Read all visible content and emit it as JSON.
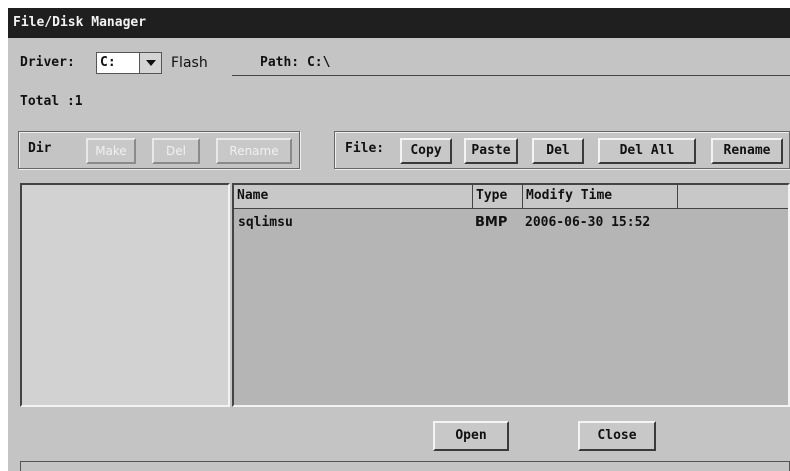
{
  "window": {
    "title": "File/Disk Manager"
  },
  "driver": {
    "label": "Driver:",
    "value": "C:",
    "media": "Flash"
  },
  "path": {
    "label": "Path:",
    "value": "C:\\"
  },
  "total": {
    "label": "Total :",
    "value": "1"
  },
  "dir_group": {
    "label": "Dir",
    "make": "Make",
    "del": "Del",
    "rename": "Rename"
  },
  "file_group": {
    "label": "File:",
    "copy": "Copy",
    "paste": "Paste",
    "del": "Del",
    "del_all": "Del All",
    "rename": "Rename"
  },
  "file_list": {
    "columns": {
      "name": "Name",
      "type": "Type",
      "modify_time": "Modify Time"
    },
    "rows": [
      {
        "name": "sqlimsu",
        "type": "BMP",
        "modify_time": "2006-06-30 15:52"
      }
    ]
  },
  "actions": {
    "open": "Open",
    "close": "Close"
  },
  "icons": {
    "dropdown": "chevron-down-icon"
  }
}
